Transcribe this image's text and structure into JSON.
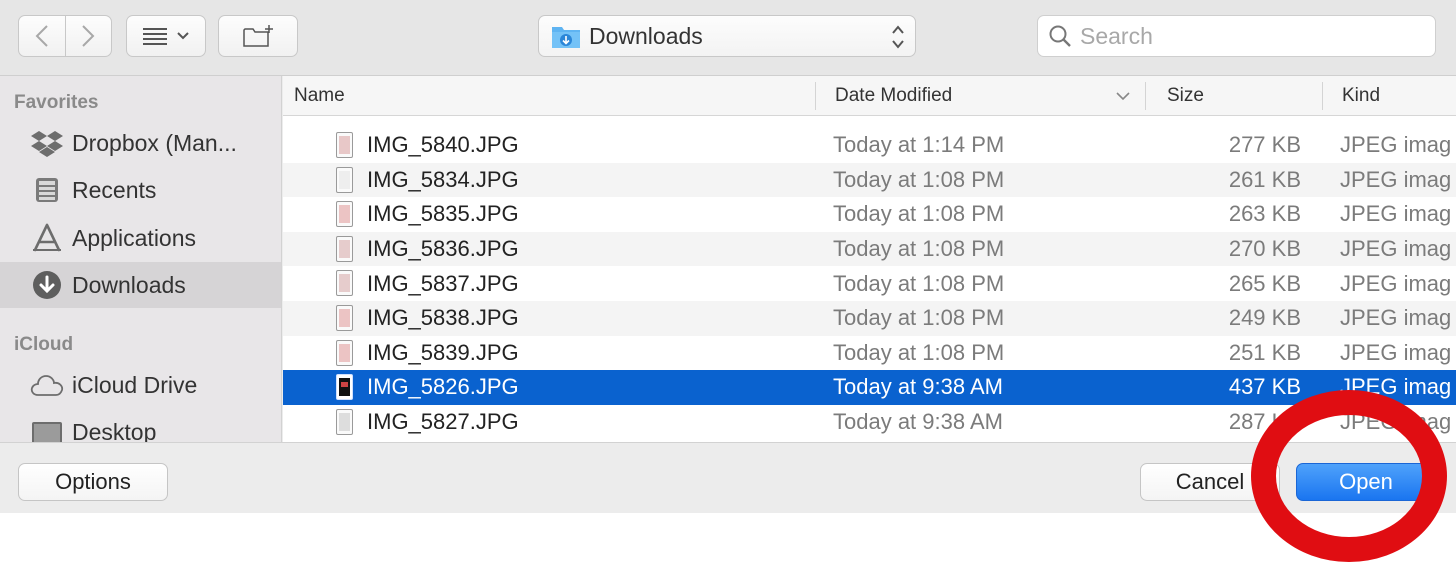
{
  "toolbar": {
    "back_icon": "chevron-left-icon",
    "forward_icon": "chevron-right-icon",
    "view_icon": "list-view-icon",
    "new_folder_icon": "new-folder-icon",
    "location": "Downloads",
    "search_placeholder": "Search"
  },
  "sidebar": {
    "favorites_heading": "Favorites",
    "favorites": [
      {
        "label": "Dropbox (Man...",
        "icon": "dropbox-icon"
      },
      {
        "label": "Recents",
        "icon": "recents-icon"
      },
      {
        "label": "Applications",
        "icon": "applications-icon"
      },
      {
        "label": "Downloads",
        "icon": "downloads-icon",
        "selected": true
      }
    ],
    "icloud_heading": "iCloud",
    "icloud": [
      {
        "label": "iCloud Drive",
        "icon": "cloud-icon"
      },
      {
        "label": "Desktop",
        "icon": "desktop-icon"
      }
    ]
  },
  "columns": {
    "name": "Name",
    "date": "Date Modified",
    "size": "Size",
    "kind": "Kind"
  },
  "files": [
    {
      "name": "IMG_5840.JPG",
      "date": "Today at 1:14 PM",
      "size": "277 KB",
      "kind": "JPEG imag"
    },
    {
      "name": "IMG_5834.JPG",
      "date": "Today at 1:08 PM",
      "size": "261 KB",
      "kind": "JPEG imag"
    },
    {
      "name": "IMG_5835.JPG",
      "date": "Today at 1:08 PM",
      "size": "263 KB",
      "kind": "JPEG imag"
    },
    {
      "name": "IMG_5836.JPG",
      "date": "Today at 1:08 PM",
      "size": "270 KB",
      "kind": "JPEG imag"
    },
    {
      "name": "IMG_5837.JPG",
      "date": "Today at 1:08 PM",
      "size": "265 KB",
      "kind": "JPEG imag"
    },
    {
      "name": "IMG_5838.JPG",
      "date": "Today at 1:08 PM",
      "size": "249 KB",
      "kind": "JPEG imag"
    },
    {
      "name": "IMG_5839.JPG",
      "date": "Today at 1:08 PM",
      "size": "251 KB",
      "kind": "JPEG imag"
    },
    {
      "name": "IMG_5826.JPG",
      "date": "Today at 9:38 AM",
      "size": "437 KB",
      "kind": "JPEG imag",
      "selected": true
    },
    {
      "name": "IMG_5827.JPG",
      "date": "Today at 9:38 AM",
      "size": "287 KB",
      "kind": "JPEG imag"
    }
  ],
  "buttons": {
    "options": "Options",
    "cancel": "Cancel",
    "open": "Open"
  },
  "colors": {
    "selection": "#0a62cf",
    "primary_button": "#1a75f0",
    "annotation": "#e00d12"
  }
}
